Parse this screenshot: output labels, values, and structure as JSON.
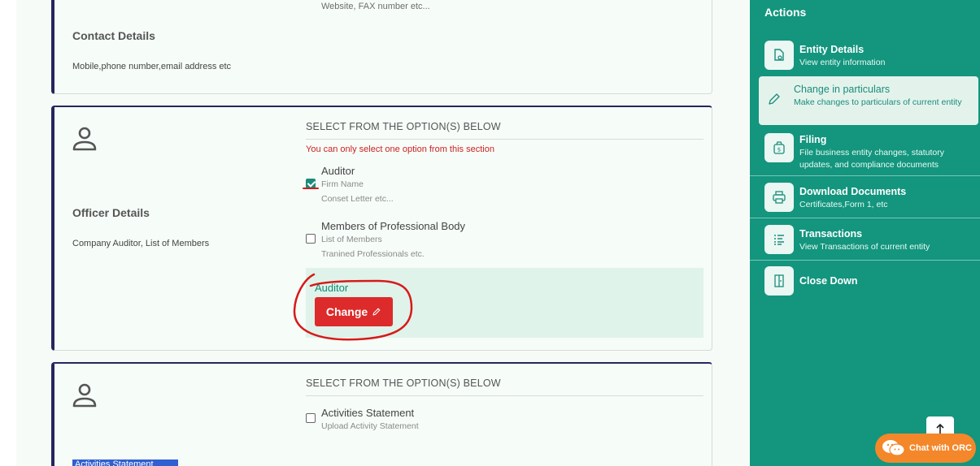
{
  "contact_card": {
    "overflow_text": "Website, FAX number etc...",
    "title": "Contact Details",
    "description": "Mobile,phone number,email address etc"
  },
  "officer_card": {
    "title": "Officer Details",
    "description": "Company Auditor, List of Members",
    "select_header": "SELECT FROM THE OPTION(S) BELOW",
    "warning": "You can only select one option from this section",
    "options": [
      {
        "title": "Auditor",
        "sub1": "Firm Name",
        "sub2": "Conset Letter etc...",
        "checked": true
      },
      {
        "title": "Members of Professional Body",
        "sub1": "List of Members",
        "sub2": "Tranined Professionals etc.",
        "checked": false
      }
    ],
    "selected_label": "Auditor",
    "change_button": "Change"
  },
  "activities_card": {
    "select_header": "SELECT FROM THE OPTION(S) BELOW",
    "options": [
      {
        "title": "Activities Statement",
        "sub1": "Upload Activity Statement",
        "checked": false
      }
    ],
    "badge": "Activities Statement"
  },
  "sidebar": {
    "title": "Actions",
    "items": [
      {
        "title": "Entity Details",
        "subtitle": "View entity information",
        "icon": "file-search-icon"
      },
      {
        "title": "Change in particulars",
        "subtitle": "Make changes to particulars of current entity",
        "icon": "pencil-icon",
        "active": true
      },
      {
        "title": "Filing",
        "subtitle": "File business entity changes, statutory updates, and compliance documents",
        "icon": "money-bag-icon"
      },
      {
        "title": "Download Documents",
        "subtitle": "Certificates,Form 1, etc",
        "icon": "printer-icon"
      },
      {
        "title": "Transactions",
        "subtitle": "View Transactions of current entity",
        "icon": "list-icon"
      },
      {
        "title": "Close Down",
        "subtitle": "",
        "icon": "door-icon"
      }
    ]
  },
  "chat_button": "Chat with ORC",
  "colors": {
    "sidebar": "#13957e",
    "accent": "#1b8c7a",
    "danger": "#dd2a2a",
    "card_border": "#26265e",
    "chat": "#f4872a"
  }
}
